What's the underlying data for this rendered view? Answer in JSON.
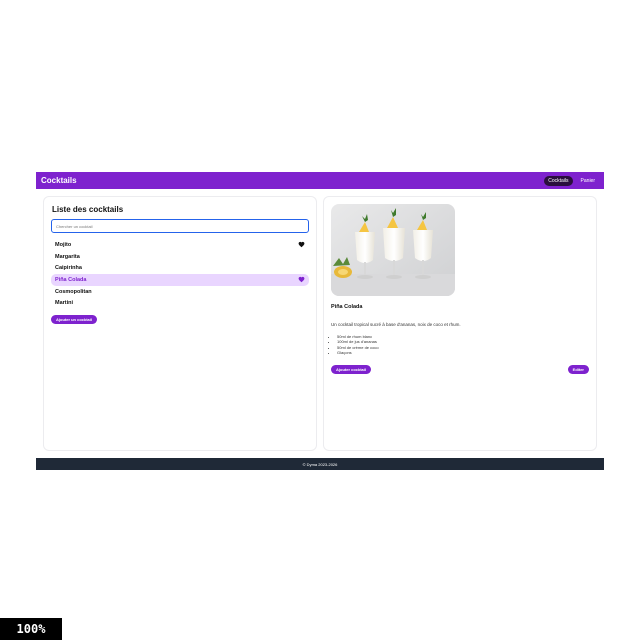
{
  "navbar": {
    "brand": "Cocktails",
    "links": [
      {
        "label": "Cocktails",
        "active": true
      },
      {
        "label": "Panier",
        "active": false
      }
    ]
  },
  "list_panel": {
    "title": "Liste des cocktails",
    "search_placeholder": "Chercher un cocktail",
    "items": [
      {
        "name": "Mojito",
        "favorite": true,
        "selected": false
      },
      {
        "name": "Margarita",
        "favorite": false,
        "selected": false
      },
      {
        "name": "Caipirinha",
        "favorite": false,
        "selected": false
      },
      {
        "name": "Piña Colada",
        "favorite": true,
        "selected": true
      },
      {
        "name": "Cosmopolitan",
        "favorite": false,
        "selected": false
      },
      {
        "name": "Martini",
        "favorite": false,
        "selected": false
      }
    ],
    "add_button": "Ajouter un cocktail"
  },
  "detail": {
    "name": "Piña Colada",
    "description": "Un cocktail tropical sucré à base d'ananas, noix de coco et rhum.",
    "ingredients": [
      "50ml de rhum blanc",
      "100ml de jus d'ananas",
      "50ml de crème de coco",
      "Glaçons"
    ],
    "add_to_cart_button": "Ajouter cocktail",
    "edit_button": "Editer"
  },
  "footer": {
    "text": "© Dyma 2023-2026"
  },
  "zoom": "100%",
  "colors": {
    "accent": "#7e22ce",
    "selected_bg": "#e9d5ff",
    "footer_bg": "#1f2937"
  }
}
